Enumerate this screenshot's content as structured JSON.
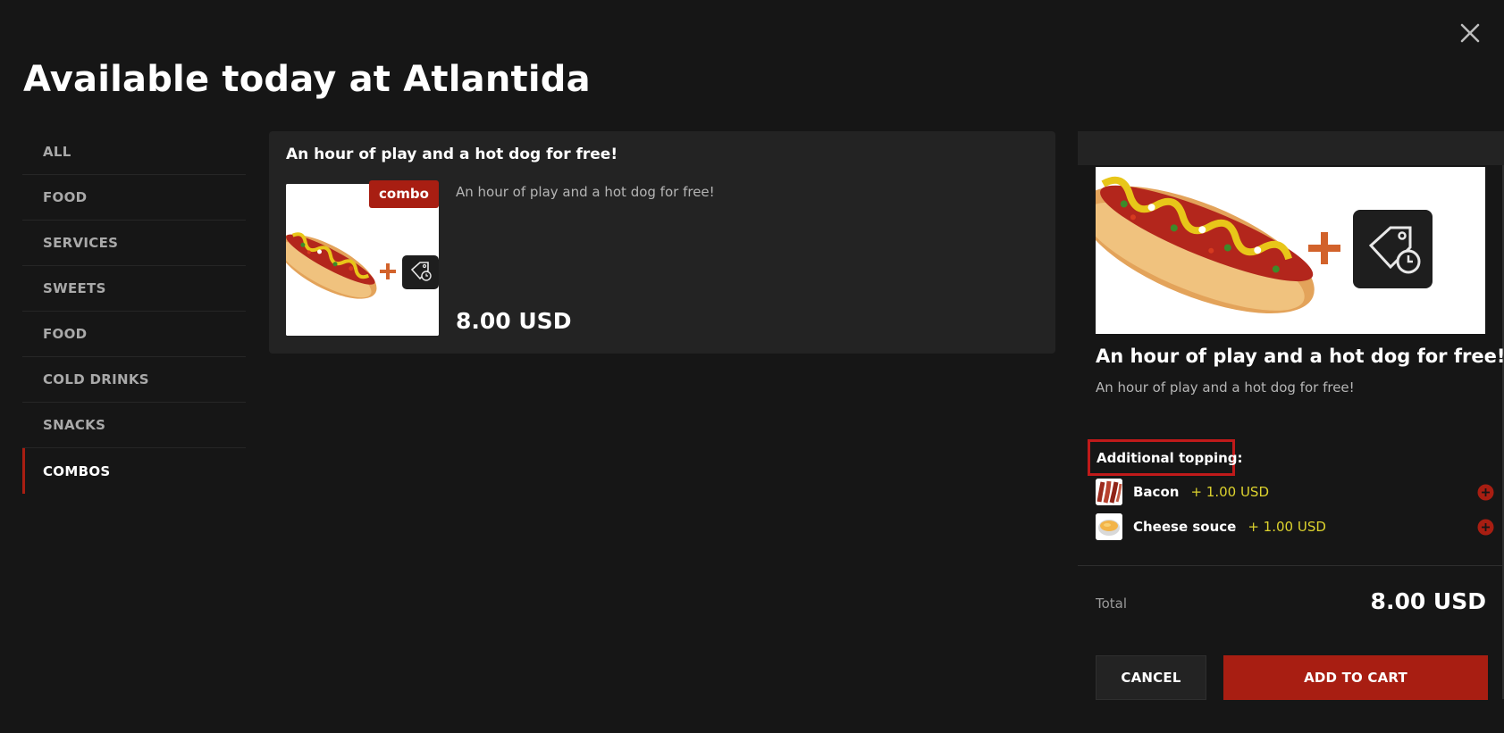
{
  "page": {
    "title": "Available today at Atlantida"
  },
  "sidebar": {
    "items": [
      {
        "label": "ALL"
      },
      {
        "label": "FOOD"
      },
      {
        "label": "SERVICES"
      },
      {
        "label": "SWEETS"
      },
      {
        "label": "FOOD"
      },
      {
        "label": "COLD DRINKS"
      },
      {
        "label": "SNACKS"
      },
      {
        "label": "COMBOS"
      }
    ],
    "active": "COMBOS"
  },
  "product_card": {
    "title": "An hour of play and a hot dog for free!",
    "badge": "combo",
    "description": "An hour of play and a hot dog for free!",
    "price": "8.00 USD"
  },
  "detail": {
    "title": "An hour of play and a hot dog for free!",
    "description": "An hour of play and a hot dog for free!",
    "toppings_heading": "Additional topping:",
    "toppings": [
      {
        "name": "Bacon",
        "price": "+ 1.00 USD",
        "icon": "bacon-icon"
      },
      {
        "name": "Cheese souce",
        "price": "+ 1.00 USD",
        "icon": "cheese-sauce-icon"
      }
    ],
    "total_label": "Total",
    "total_value": "8.00 USD",
    "cancel_label": "CANCEL",
    "add_to_cart_label": "ADD TO CART"
  },
  "icons": {
    "close": "close-icon",
    "add": "plus-circle-icon",
    "ticket": "time-tag-icon"
  },
  "colors": {
    "background": "#161616",
    "card": "#232323",
    "accent": "#a81e12",
    "topping_price": "#dcd22e"
  }
}
